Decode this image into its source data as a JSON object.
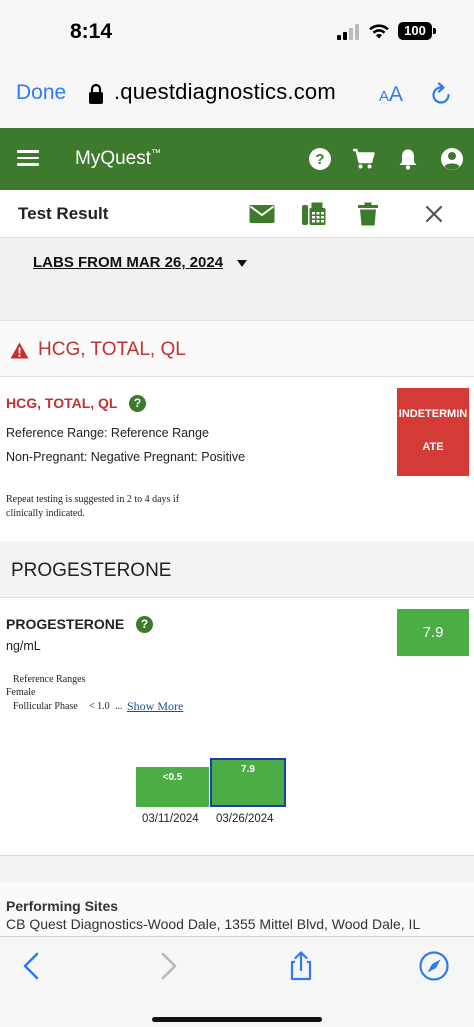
{
  "status_bar": {
    "time": "8:14",
    "battery": "100"
  },
  "browser": {
    "done_label": "Done",
    "url": ".questdiagnostics.com",
    "text_size_small": "A",
    "text_size_big": "A"
  },
  "app_header": {
    "brand": "MyQuest",
    "trademark": "™",
    "accent_color": "#3d7a2e",
    "icons": [
      "menu-icon",
      "help-icon",
      "cart-icon",
      "bell-icon",
      "account-icon"
    ]
  },
  "result_bar": {
    "title": "Test Result",
    "icons": [
      "mail-icon",
      "fax-icon",
      "trash-icon",
      "close-icon"
    ]
  },
  "labs": {
    "label": "LABS FROM MAR 26, 2024"
  },
  "hcg": {
    "section_title": "HCG, TOTAL, QL",
    "test_name": "HCG, TOTAL, QL",
    "help_glyph": "?",
    "reference_line": "Reference Range: Reference Range",
    "pregnancy_line": "Non-Pregnant: Negative Pregnant: Positive",
    "note_line1": "Repeat testing is suggested in 2 to 4 days if",
    "note_line2": "clinically indicated.",
    "result_line1": "INDETERMIN",
    "result_line2": "ATE",
    "result_color": "#d53b36"
  },
  "progesterone": {
    "section_title": "PROGESTERONE",
    "test_name": "PROGESTERONE",
    "help_glyph": "?",
    "units": "ng/mL",
    "result": "7.9",
    "result_color": "#4cac46",
    "ref_title": "Reference Ranges",
    "ref_sex": "Female",
    "ref_phase": "Follicular Phase",
    "ref_value": "< 1.0",
    "ellipsis": "...",
    "show_more": "Show More",
    "history": [
      {
        "date": "03/11/2024",
        "label": "<0.5",
        "selected": false
      },
      {
        "date": "03/26/2024",
        "label": "7.9",
        "selected": true
      }
    ]
  },
  "performing_sites": {
    "title": "Performing Sites",
    "line": "CB Quest Diagnostics-Wood Dale, 1355 Mittel Blvd, Wood Dale, IL"
  },
  "bottom_toolbar": {
    "icons": [
      "back-icon",
      "forward-icon",
      "share-icon",
      "compass-icon"
    ]
  }
}
